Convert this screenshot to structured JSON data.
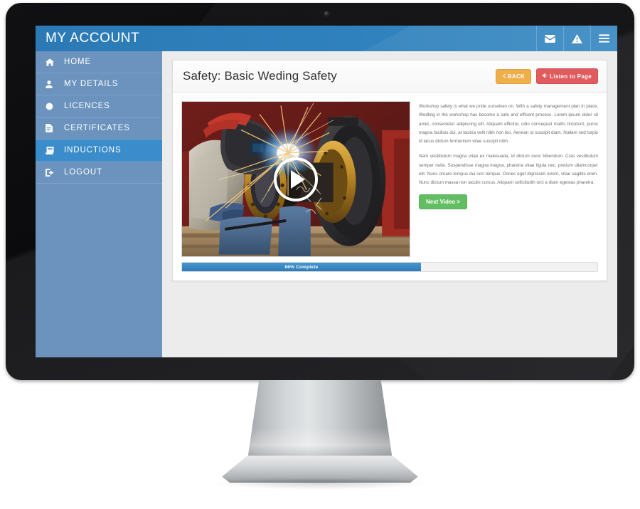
{
  "app": {
    "title": "MY ACCOUNT",
    "header_icons": [
      {
        "name": "mail-icon",
        "label": "Messages"
      },
      {
        "name": "alert-icon",
        "label": "Alerts"
      },
      {
        "name": "menu-icon",
        "label": "Menu"
      }
    ]
  },
  "sidebar": {
    "items": [
      {
        "label": "HOME",
        "icon": "home-icon",
        "active": false
      },
      {
        "label": "MY DETAILS",
        "icon": "user-icon",
        "active": false
      },
      {
        "label": "LICENCES",
        "icon": "circle-icon",
        "active": false
      },
      {
        "label": "CERTIFICATES",
        "icon": "document-icon",
        "active": false
      },
      {
        "label": "INDUCTIONS",
        "icon": "book-icon",
        "active": true
      },
      {
        "label": "LOGOUT",
        "icon": "logout-icon",
        "active": false
      }
    ]
  },
  "page": {
    "title": "Safety: Basic Weding Safety",
    "back_button": "BACK",
    "listen_button": "Listen to Page",
    "next_button": "Next Video >",
    "video": {
      "alt": "Welder in protective gear welding a large brass flanged component with sparks",
      "play_label": "Play video"
    },
    "paragraphs": [
      "Workshop safety is what we pride ourselves on. With a  safety management plan in place, Wedling in the workshop has become a safe and efficent process. Lorem ipsum dolor sit amet, consectetur adipiscing elit. Aliquam efficitur, odio consequat mattis tincidunt, purus magna facilisis dui, at lacinia velit nibh non leo. Aenean ut suscipit diam. Nullam sed turpis id lacus dictum fermentum vitae suscipit nibh.",
      "Nam vestibulum magna vitae ex malesuada, id dictum nunc bibendum. Cras vestibulum semper nulla. Suspendisse magna magna, pharetra vitae ligula nec, pretium ullamcorper elit. Nunc ornare tempus dui non tempus. Donec eget dignissim lorem, vitae sagittis enim. Nunc dictum massa non iaculis cursus. Aliquam sollicitudin orci a diam egestas pharetra."
    ],
    "progress": {
      "label": "66% Complete",
      "percent": 66,
      "fill_width_percent": 57.5
    }
  },
  "colors": {
    "brand_blue": "#2f81bd",
    "sidebar_blue": "#6b93bd",
    "active_blue": "#3b8ccb",
    "back_orange": "#eeae4a",
    "listen_red": "#e15a5e",
    "next_green": "#63bd63",
    "progress_blue": "#2c7cb8",
    "screen_bg": "#ececec"
  }
}
